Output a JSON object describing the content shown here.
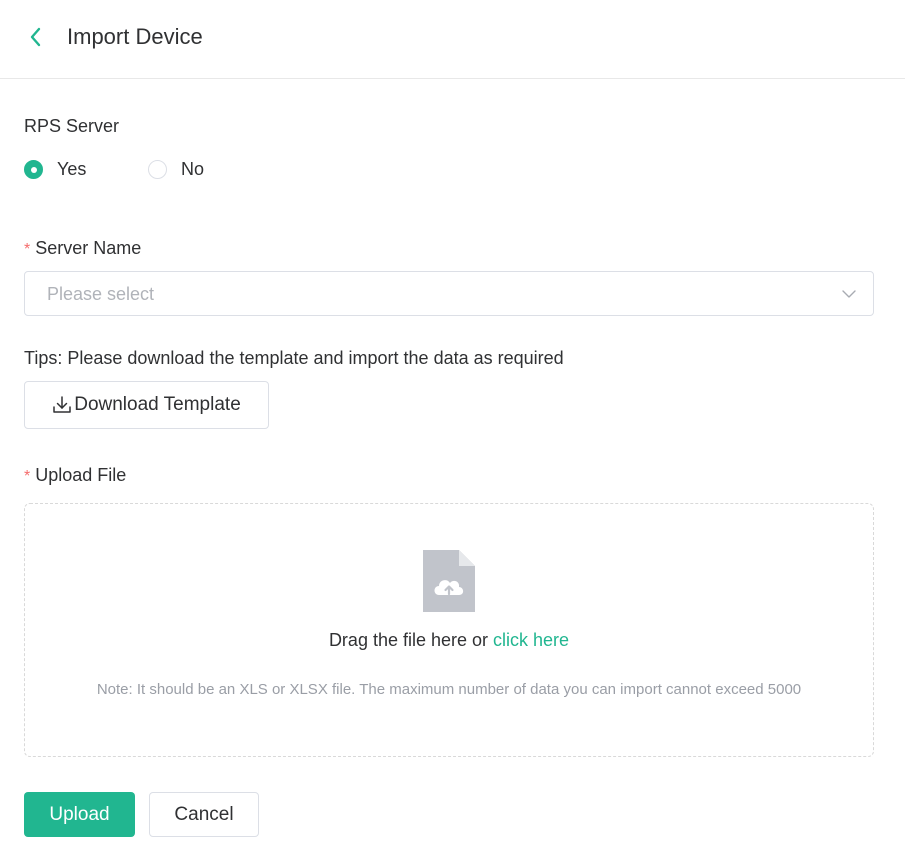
{
  "header": {
    "title": "Import Device",
    "back_icon": "chevron-left-icon"
  },
  "rps_server": {
    "label": "RPS Server",
    "options": [
      {
        "label": "Yes",
        "checked": true
      },
      {
        "label": "No",
        "checked": false
      }
    ]
  },
  "server_name": {
    "required_mark": "*",
    "label": "Server Name",
    "placeholder": "Please select"
  },
  "tips": "Tips: Please download the template and import the data as required",
  "download_button": {
    "label": "Download Template",
    "icon": "download-icon"
  },
  "upload_file": {
    "required_mark": "*",
    "label": "Upload File",
    "drop_text": "Drag the file here or ",
    "click_text": "click here",
    "note": "Note: It should be an XLS or XLSX file. The maximum number of data you can import cannot exceed 5000",
    "icon": "file-upload-icon"
  },
  "actions": {
    "upload_label": "Upload",
    "cancel_label": "Cancel"
  },
  "colors": {
    "accent": "#21b690",
    "required": "#f56c6c",
    "placeholder": "#b0b3b9",
    "note": "#9a9ea6"
  }
}
